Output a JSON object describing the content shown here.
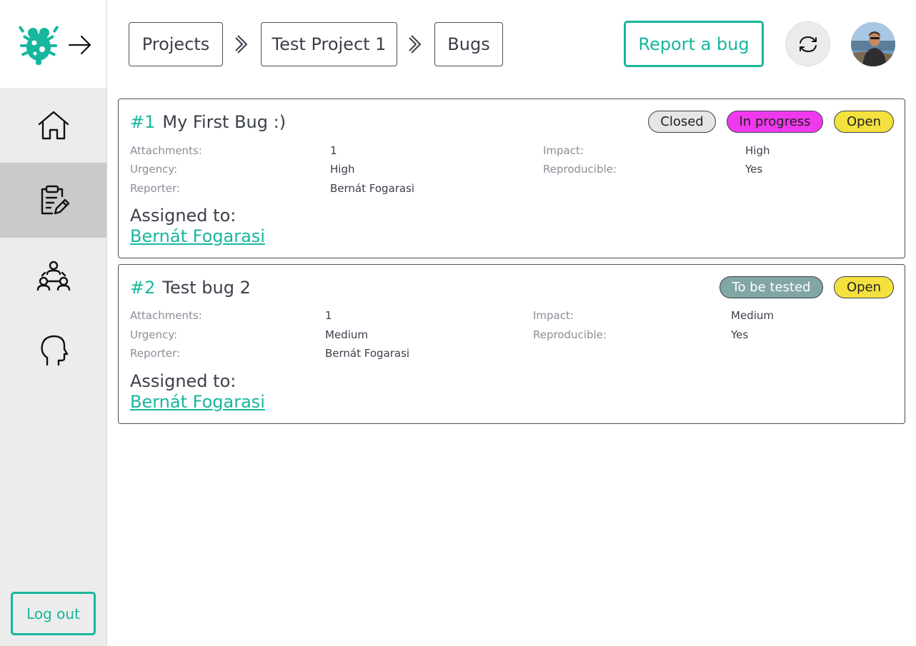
{
  "colors": {
    "accent": "#17b79d",
    "status_closed": "#e6e6e6",
    "status_in_progress": "#f039ef",
    "status_open": "#f5e13d",
    "status_to_be_tested": "#82a6a3"
  },
  "sidebar": {
    "logo_icon": "bug-logo-icon",
    "expand_icon": "arrow-right-icon",
    "items": [
      {
        "icon": "home-icon"
      },
      {
        "icon": "clipboard-edit-icon",
        "active": true
      },
      {
        "icon": "team-icon"
      },
      {
        "icon": "head-profile-icon"
      }
    ],
    "logout_label": "Log out"
  },
  "header": {
    "breadcrumbs": [
      "Projects",
      "Test Project 1",
      "Bugs"
    ],
    "report_label": "Report a bug",
    "refresh_icon": "refresh-icon",
    "avatar_icon": "user-avatar"
  },
  "labels": {
    "attachments": "Attachments:",
    "urgency": "Urgency:",
    "reporter": "Reporter:",
    "impact": "Impact:",
    "reproducible": "Reproducible:",
    "assigned_to": "Assigned to:"
  },
  "bugs": [
    {
      "number": "#1",
      "title": "My First Bug :)",
      "statuses": [
        "Closed",
        "In progress",
        "Open"
      ],
      "attachments": "1",
      "urgency": "High",
      "reporter": "Bernát Fogarasi",
      "impact": "High",
      "reproducible": "Yes",
      "assignee": "Bernát Fogarasi"
    },
    {
      "number": "#2",
      "title": "Test bug 2",
      "statuses": [
        "To be tested",
        "Open"
      ],
      "attachments": "1",
      "urgency": "Medium",
      "reporter": "Bernát Fogarasi",
      "impact": "Medium",
      "reproducible": "Yes",
      "assignee": "Bernát Fogarasi"
    }
  ]
}
